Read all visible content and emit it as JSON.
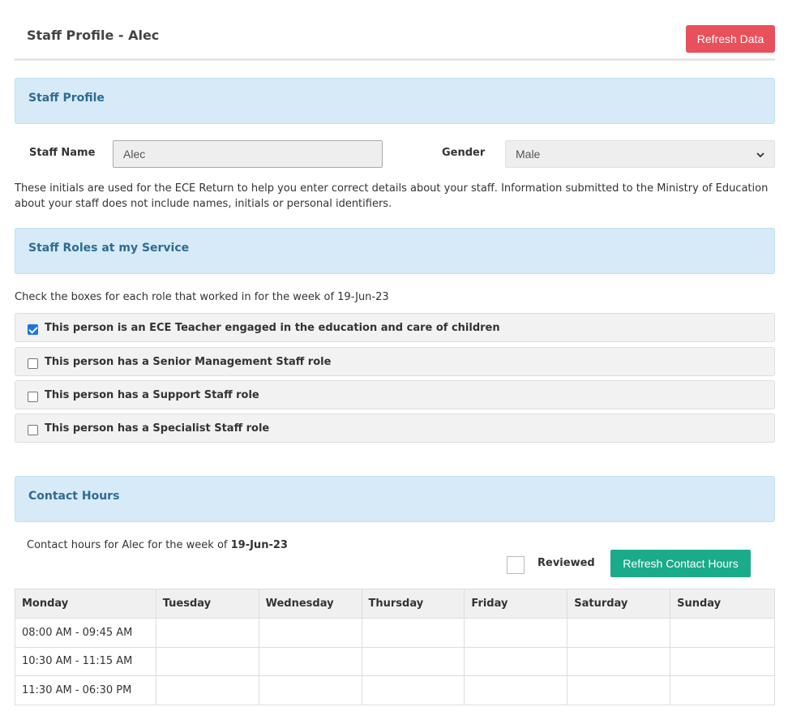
{
  "header": {
    "title": "Staff Profile -  Alec",
    "refresh_label": "Refresh Data"
  },
  "profile_panel": {
    "title": "Staff Profile"
  },
  "profile": {
    "name_label": "Staff Name",
    "name_value": "Alec",
    "gender_label": "Gender",
    "gender_value": "Male",
    "help_text": "These initials are used for the ECE Return to help you enter correct details about your staff. Information submitted to the Ministry of Education about your staff does not include names, initials or personal identifiers."
  },
  "roles_panel": {
    "title": "Staff Roles at my Service"
  },
  "roles": {
    "intro": "Check the boxes for each role that worked in for the week of 19-Jun-23",
    "items": [
      {
        "label": "This person is an ECE Teacher engaged in the education and care of children",
        "checked": true
      },
      {
        "label": "This person has a Senior Management Staff role",
        "checked": false
      },
      {
        "label": "This person has a Support Staff role",
        "checked": false
      },
      {
        "label": "This person has a Specialist Staff role",
        "checked": false
      }
    ]
  },
  "contact_panel": {
    "title": "Contact Hours"
  },
  "contact": {
    "intro_prefix": "Contact hours for Alec for the week of ",
    "week": "19-Jun-23",
    "reviewed_label": "Reviewed",
    "reviewed_checked": false,
    "refresh_label": "Refresh Contact Hours"
  },
  "hours_table": {
    "columns": [
      "Monday",
      "Tuesday",
      "Wednesday",
      "Thursday",
      "Friday",
      "Saturday",
      "Sunday"
    ],
    "rows": [
      [
        "08:00 AM - 09:45 AM",
        "",
        "",
        "",
        "",
        "",
        ""
      ],
      [
        "10:30 AM - 11:15 AM",
        "",
        "",
        "",
        "",
        "",
        ""
      ],
      [
        "11:30 AM - 06:30 PM",
        "",
        "",
        "",
        "",
        "",
        ""
      ]
    ]
  },
  "colors": {
    "danger": "#e8505b",
    "success": "#1aab8a",
    "panel_bg": "#d6eaf7",
    "panel_title": "#2f6b93"
  }
}
